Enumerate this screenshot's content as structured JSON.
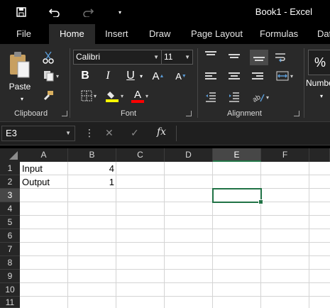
{
  "title_bar": {
    "title": "Book1  -  Excel",
    "save_icon": "save-icon",
    "undo_icon": "undo-icon",
    "redo_icon": "redo-icon",
    "customize_icon": "customize-qat-icon"
  },
  "tabs": [
    "File",
    "Home",
    "Insert",
    "Draw",
    "Page Layout",
    "Formulas",
    "Data"
  ],
  "active_tab": "Home",
  "ribbon": {
    "clipboard": {
      "label": "Clipboard",
      "paste": "Paste"
    },
    "font": {
      "label": "Font",
      "name": "Calibri",
      "size": "11",
      "grow": "A",
      "shrink": "A",
      "bold": "B",
      "italic": "I",
      "underline": "U",
      "highlight_color": "#ffff00",
      "font_color": "#ff0000",
      "font_color_letter": "A"
    },
    "alignment": {
      "label": "Alignment"
    },
    "number": {
      "label": "Numbe",
      "percent": "%"
    }
  },
  "formula_bar": {
    "name_box": "E3",
    "fx": "fx",
    "formula": ""
  },
  "sheet": {
    "columns": [
      "A",
      "B",
      "C",
      "D",
      "E",
      "F"
    ],
    "rows": [
      "1",
      "2",
      "3",
      "4",
      "5",
      "6",
      "7",
      "8",
      "9",
      "10",
      "11"
    ],
    "selected_cell": "E3",
    "cells": {
      "A1": "Input",
      "B1": "4",
      "A2": "Output",
      "B2": "1"
    }
  },
  "colors": {
    "accent_green": "#217346",
    "ribbon_bg": "#292929",
    "titlebar_bg": "#000000"
  }
}
